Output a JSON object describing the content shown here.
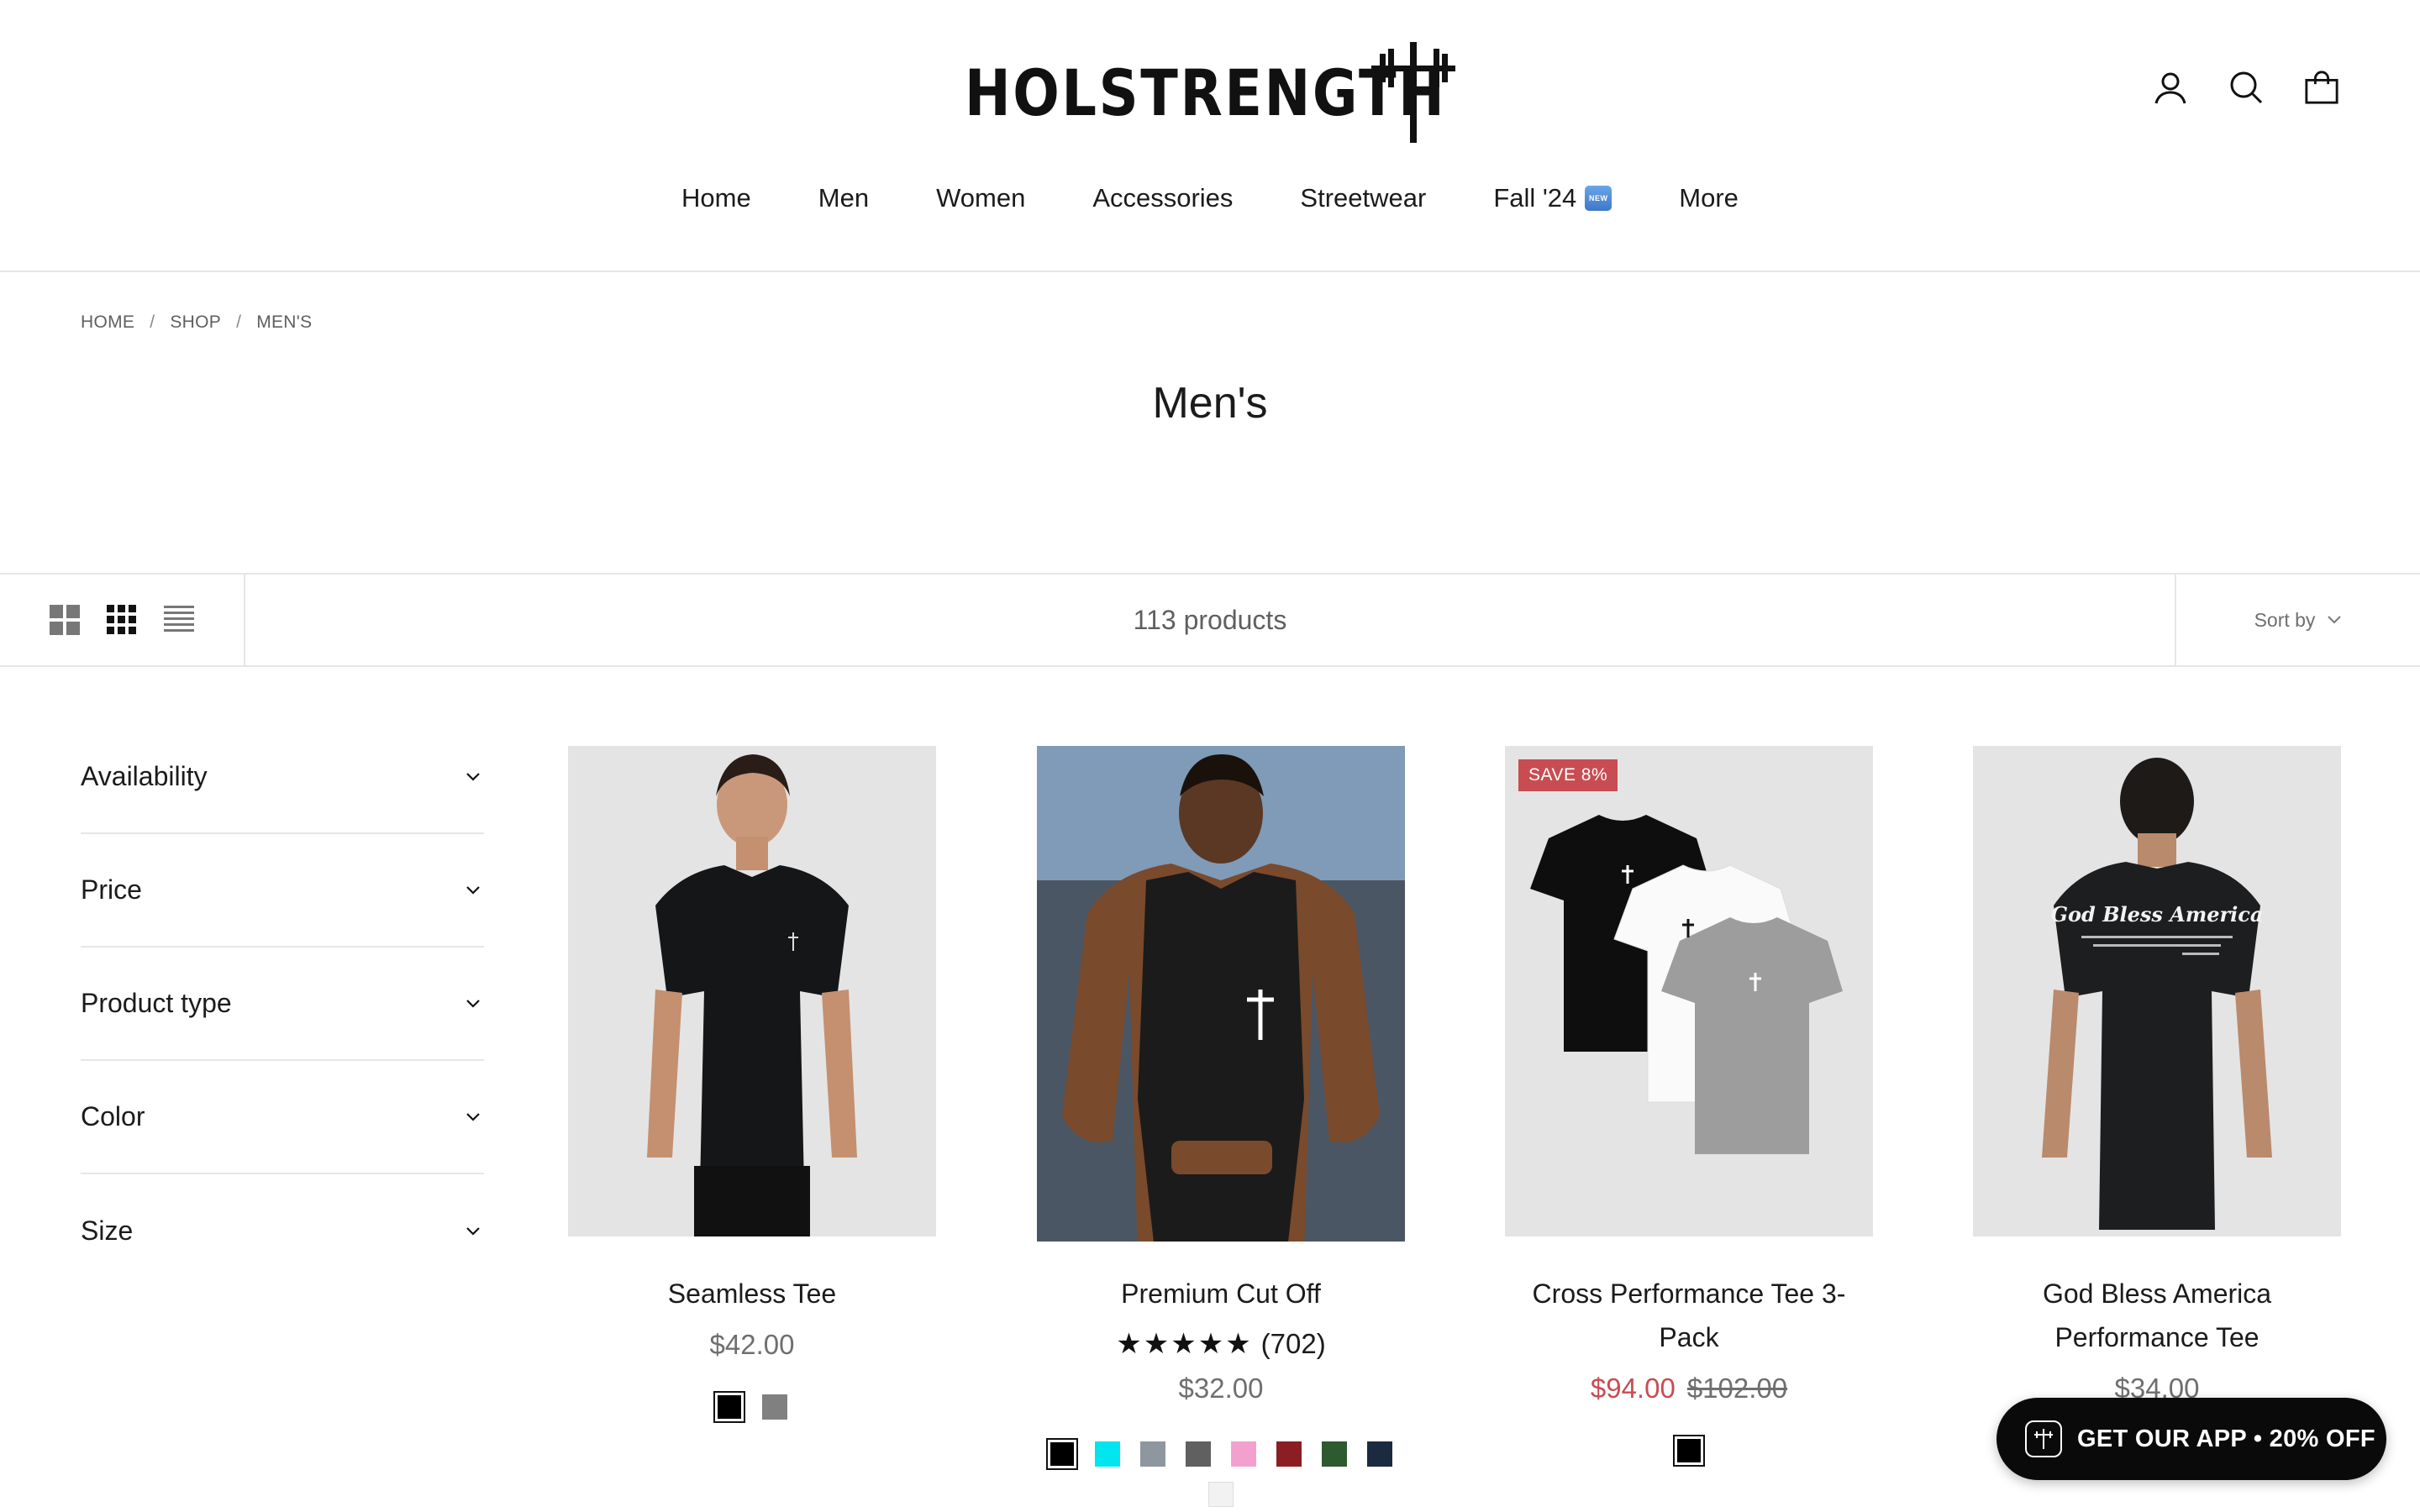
{
  "brand": {
    "logo_text": "HOLSTRENGTH"
  },
  "header": {
    "icons": [
      "account-icon",
      "search-icon",
      "cart-icon"
    ],
    "nav": [
      {
        "label": "Home"
      },
      {
        "label": "Men"
      },
      {
        "label": "Women"
      },
      {
        "label": "Accessories"
      },
      {
        "label": "Streetwear"
      },
      {
        "label": "Fall '24",
        "badge": "NEW"
      },
      {
        "label": "More"
      }
    ]
  },
  "breadcrumb": {
    "home": "HOME",
    "shop": "SHOP",
    "current": "MEN'S",
    "separator": "/"
  },
  "page_title": "Men's",
  "toolbar": {
    "product_count": "113 products",
    "sort_label": "Sort by"
  },
  "filters": [
    {
      "label": "Availability"
    },
    {
      "label": "Price"
    },
    {
      "label": "Product type"
    },
    {
      "label": "Color"
    },
    {
      "label": "Size"
    }
  ],
  "products": [
    {
      "title": "Seamless Tee",
      "price": "$42.00",
      "swatches": [
        "#000000",
        "#808080"
      ]
    },
    {
      "title": "Premium Cut Off",
      "rating_stars": "★★★★★",
      "rating_count": "(702)",
      "price": "$32.00",
      "swatches": [
        "#000000",
        "#00e5ee",
        "#8e979f",
        "#606060",
        "#f4a0cf",
        "#8b1e22",
        "#2e5a30",
        "#1c2a40",
        "#f2f2f2"
      ]
    },
    {
      "title": "Cross Performance Tee 3-Pack",
      "badge": "SAVE 8%",
      "price_sale": "$94.00",
      "price_compare": "$102.00",
      "swatches": [
        "#000000"
      ]
    },
    {
      "title": "God Bless America Performance Tee",
      "shirt_print_title": "God Bless America",
      "price": "$34.00"
    }
  ],
  "app_promo": {
    "label": "GET OUR APP • 20% OFF"
  },
  "colors": {
    "sale": "#c74d52",
    "text": "#1c1b1b",
    "muted": "#6f6f6f",
    "divider": "#e6e6e6"
  }
}
